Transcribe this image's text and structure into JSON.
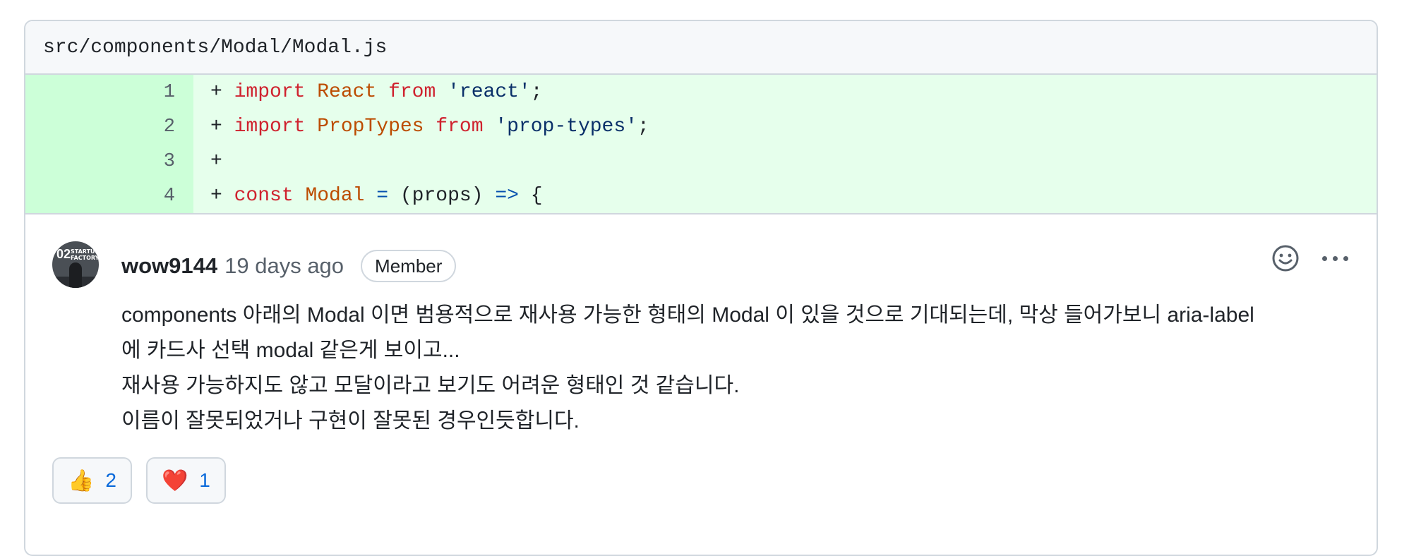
{
  "file": {
    "path": "src/components/Modal/Modal.js"
  },
  "diff": {
    "lines": [
      {
        "num": "1",
        "tokens": [
          {
            "t": "+ ",
            "c": "pl"
          },
          {
            "t": "import",
            "c": "kw"
          },
          {
            "t": " ",
            "c": "pl"
          },
          {
            "t": "React",
            "c": "id"
          },
          {
            "t": " ",
            "c": "pl"
          },
          {
            "t": "from",
            "c": "kw"
          },
          {
            "t": " ",
            "c": "pl"
          },
          {
            "t": "'react'",
            "c": "str"
          },
          {
            "t": ";",
            "c": "pl"
          }
        ]
      },
      {
        "num": "2",
        "tokens": [
          {
            "t": "+ ",
            "c": "pl"
          },
          {
            "t": "import",
            "c": "kw"
          },
          {
            "t": " ",
            "c": "pl"
          },
          {
            "t": "PropTypes",
            "c": "id"
          },
          {
            "t": " ",
            "c": "pl"
          },
          {
            "t": "from",
            "c": "kw"
          },
          {
            "t": " ",
            "c": "pl"
          },
          {
            "t": "'prop-types'",
            "c": "str"
          },
          {
            "t": ";",
            "c": "pl"
          }
        ]
      },
      {
        "num": "3",
        "tokens": [
          {
            "t": "+",
            "c": "pl"
          }
        ]
      },
      {
        "num": "4",
        "tokens": [
          {
            "t": "+ ",
            "c": "pl"
          },
          {
            "t": "const",
            "c": "kw"
          },
          {
            "t": " ",
            "c": "pl"
          },
          {
            "t": "Modal",
            "c": "id"
          },
          {
            "t": " ",
            "c": "pl"
          },
          {
            "t": "=",
            "c": "op"
          },
          {
            "t": " (props) ",
            "c": "pl"
          },
          {
            "t": "=>",
            "c": "op"
          },
          {
            "t": " {",
            "c": "pl"
          }
        ]
      }
    ]
  },
  "comment": {
    "author": "wow9144",
    "timestamp": "19 days ago",
    "role_badge": "Member",
    "avatar_text": "02",
    "avatar_small_text": "STARTUP FACTORY",
    "lines": [
      "components 아래의 Modal 이면 범용적으로 재사용 가능한 형태의 Modal 이 있을 것으로 기대되는데, 막상 들어가보니 aria-label",
      "에 카드사 선택 modal 같은게 보이고...",
      "재사용 가능하지도 않고 모달이라고 보기도 어려운 형태인 것 같습니다.",
      "이름이 잘못되었거나 구현이 잘못된 경우인듯합니다."
    ],
    "reactions": [
      {
        "emoji": "👍",
        "icon": "thumbs-up-icon",
        "count": "2"
      },
      {
        "emoji": "❤️",
        "icon": "heart-icon",
        "count": "1"
      }
    ]
  },
  "colors": {
    "added_bg": "#e6ffec",
    "added_gutter": "#ccffd8",
    "keyword": "#cf222e",
    "identifier": "#bc4c00",
    "string": "#0a3069",
    "reaction_count": "#0969da"
  }
}
